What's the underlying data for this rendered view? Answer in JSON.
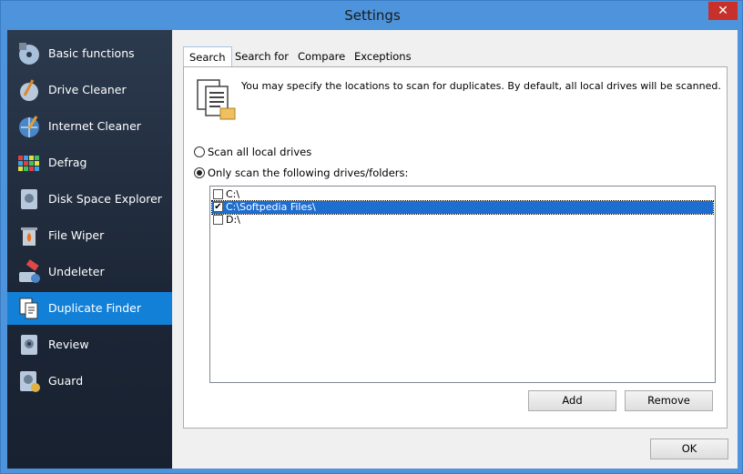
{
  "window": {
    "title": "Settings",
    "close_glyph": "✕"
  },
  "sidebar": {
    "items": [
      {
        "label": "Basic functions",
        "icon": "cd-gear-icon"
      },
      {
        "label": "Drive Cleaner",
        "icon": "broom-disk-icon"
      },
      {
        "label": "Internet Cleaner",
        "icon": "globe-broom-icon"
      },
      {
        "label": "Defrag",
        "icon": "defrag-grid-icon"
      },
      {
        "label": "Disk Space Explorer",
        "icon": "disk-magnifier-icon"
      },
      {
        "label": "File Wiper",
        "icon": "trash-fire-icon"
      },
      {
        "label": "Undeleter",
        "icon": "eraser-disk-icon"
      },
      {
        "label": "Duplicate Finder",
        "icon": "duplicate-documents-icon",
        "active": true
      },
      {
        "label": "Review",
        "icon": "disk-review-icon"
      },
      {
        "label": "Guard",
        "icon": "disk-guard-icon"
      }
    ]
  },
  "tabs": [
    {
      "label": "Search",
      "active": true
    },
    {
      "label": "Search for"
    },
    {
      "label": "Compare"
    },
    {
      "label": "Exceptions"
    }
  ],
  "panel": {
    "info": "You may specify the locations to scan for duplicates. By default, all local drives will be scanned.",
    "radio_all": "Scan all local drives",
    "radio_only": "Only scan the following drives/folders:",
    "selected_radio": "only",
    "locations": [
      {
        "label": "C:\\",
        "checked": false,
        "selected": false
      },
      {
        "label": "C:\\Softpedia Files\\",
        "checked": true,
        "selected": true
      },
      {
        "label": "D:\\",
        "checked": false,
        "selected": false
      }
    ],
    "add_label": "Add",
    "remove_label": "Remove"
  },
  "footer": {
    "ok_label": "OK"
  },
  "colors": {
    "accent": "#1380d8",
    "sidebar_bg": "#1c2636",
    "title_bg": "#4d94dc",
    "close_bg": "#c7302b"
  }
}
